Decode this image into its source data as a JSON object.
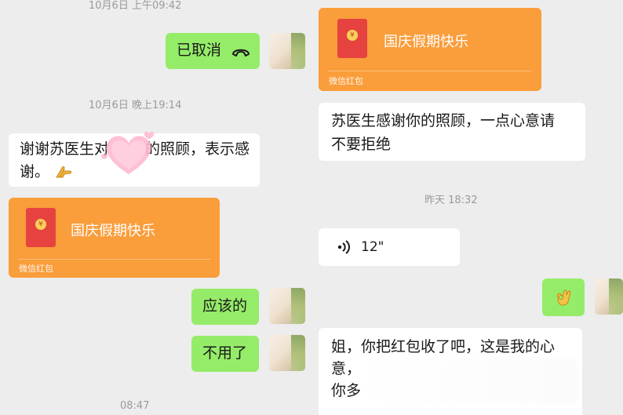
{
  "left": {
    "timestamp1": "10月6日 上午09:42",
    "call_status": "已取消",
    "timestamp2": "10月6日 晚上19:14",
    "thanks_msg": "谢谢苏医生对她的照顾，表示感谢。",
    "thanks_msg_line1": "谢谢苏医生对",
    "thanks_msg_line1b": "的照顾，表示感",
    "thanks_msg_line2": "谢。",
    "red_packet_title": "国庆假期快乐",
    "red_packet_label": "微信红包",
    "reply1": "应该的",
    "reply2": "不用了",
    "timestamp3": "08:47"
  },
  "right": {
    "red_packet_title": "国庆假期快乐",
    "red_packet_label": "微信红包",
    "msg1_line1": "苏医生感谢你的照顾，一点心意请",
    "msg1_line2": "不要拒绝",
    "timestamp": "昨天 18:32",
    "voice_duration": "12\"",
    "msg2_line1": "姐，你把红包收了吧，这是我的心",
    "msg2_line2": "意，",
    "msg2_line3": "你多"
  },
  "icons": {
    "call": "phone-hangup-icon",
    "voice": "voice-wave-icon",
    "thumb": "ok-hand-emoji",
    "hands": "clasped-hands-emoji",
    "heart": "heart-sticker"
  },
  "colors": {
    "background": "#ededed",
    "bubble_self": "#95ec69",
    "bubble_other": "#ffffff",
    "red_packet": "#fa9d3b",
    "envelope": "#e64340"
  }
}
